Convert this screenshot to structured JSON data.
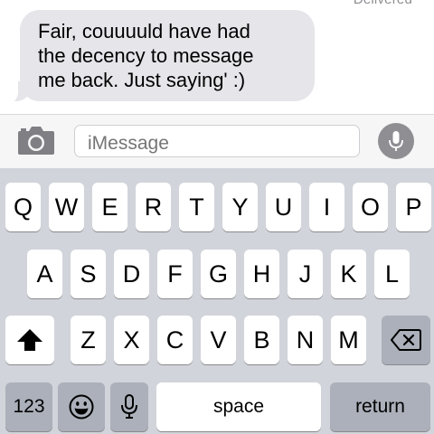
{
  "conversation": {
    "status": "Delivered",
    "bubble_lines": [
      "Fair, couuuuld have had",
      "the decency to message",
      "me back. Just saying' :)"
    ]
  },
  "input_bar": {
    "placeholder": "iMessage",
    "camera_icon": "camera-icon",
    "mic_icon": "microphone-icon"
  },
  "keyboard": {
    "row1": [
      "Q",
      "W",
      "E",
      "R",
      "T",
      "Y",
      "U",
      "I",
      "O",
      "P"
    ],
    "row2": [
      "A",
      "S",
      "D",
      "F",
      "G",
      "H",
      "J",
      "K",
      "L"
    ],
    "row3": [
      "Z",
      "X",
      "C",
      "V",
      "B",
      "N",
      "M"
    ],
    "shift_icon": "shift-arrow-icon",
    "delete_icon": "delete-backspace-icon",
    "numbers_label": "123",
    "emoji_icon": "emoji-face-icon",
    "dictation_icon": "microphone-icon",
    "space_label": "space",
    "return_label": "return"
  },
  "colors": {
    "bubble": "#e5e5ea",
    "keyboard_bg": "#d1d4da",
    "key_dark": "#abb0ba",
    "accent_grey": "#8e8e93"
  }
}
